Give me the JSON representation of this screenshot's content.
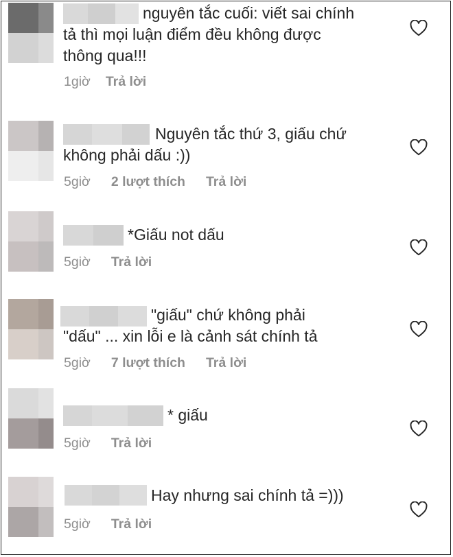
{
  "comments": [
    {
      "text": "nguyên tắc cuối: viết sai chính\ntả thì mọi luận điểm đều không được\nthông qua!!!",
      "time": "1giờ",
      "likes": "",
      "reply": "Trả lời"
    },
    {
      "text": "Nguyên tắc thứ 3, giấu chứ\nkhông phải dấu :))",
      "time": "5giờ",
      "likes": "2 lượt thích",
      "reply": "Trả lời"
    },
    {
      "text": "*Giấu not dấu",
      "time": "5giờ",
      "likes": "",
      "reply": "Trả lời"
    },
    {
      "text": "\"giấu\" chứ không phải\n\"dấu\" ... xin lỗi e là cảnh sát chính tả",
      "time": "5giờ",
      "likes": "7 lượt thích",
      "reply": "Trả lời"
    },
    {
      "text": "* giấu",
      "time": "5giờ",
      "likes": "",
      "reply": "Trả lời"
    },
    {
      "text": "Hay nhưng sai chính tả =)))",
      "time": "5giờ",
      "likes": "",
      "reply": "Trả lời"
    }
  ],
  "colors": {
    "text": "#262626",
    "meta": "#8e8e8e",
    "heart": "#262626"
  },
  "icons": {
    "like": "heart-outline-icon"
  }
}
